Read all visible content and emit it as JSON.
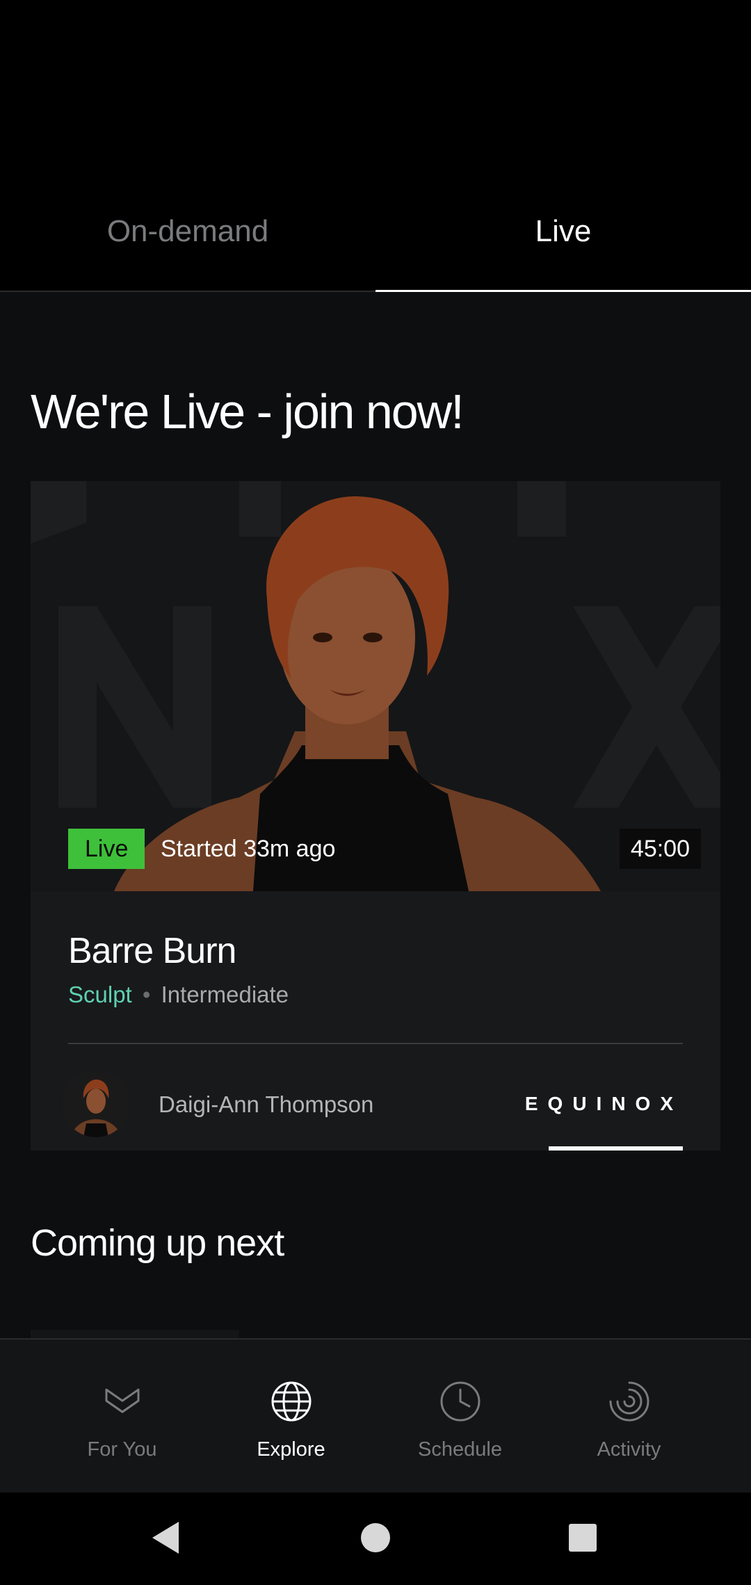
{
  "tabs": {
    "on_demand": "On-demand",
    "live": "Live",
    "active": "Live"
  },
  "live_section": {
    "title": "We're Live - join now!"
  },
  "live_card": {
    "badge": "Live",
    "started": "Started 33m ago",
    "duration": "45:00",
    "class_title": "Barre Burn",
    "category": "Sculpt",
    "separator": "•",
    "level": "Intermediate",
    "instructor": "Daigi-Ann Thompson",
    "brand": "EQUINOX"
  },
  "next_section": {
    "title": "Coming up next"
  },
  "bottom_nav": [
    {
      "label": "For You",
      "icon": "heart-chevron-icon",
      "active": false
    },
    {
      "label": "Explore",
      "icon": "globe-icon",
      "active": true
    },
    {
      "label": "Schedule",
      "icon": "clock-icon",
      "active": false
    },
    {
      "label": "Activity",
      "icon": "activity-rings-icon",
      "active": false
    }
  ],
  "colors": {
    "live_green": "#3ec03a",
    "category_teal": "#5fd0b1",
    "background": "#0d0e10"
  }
}
